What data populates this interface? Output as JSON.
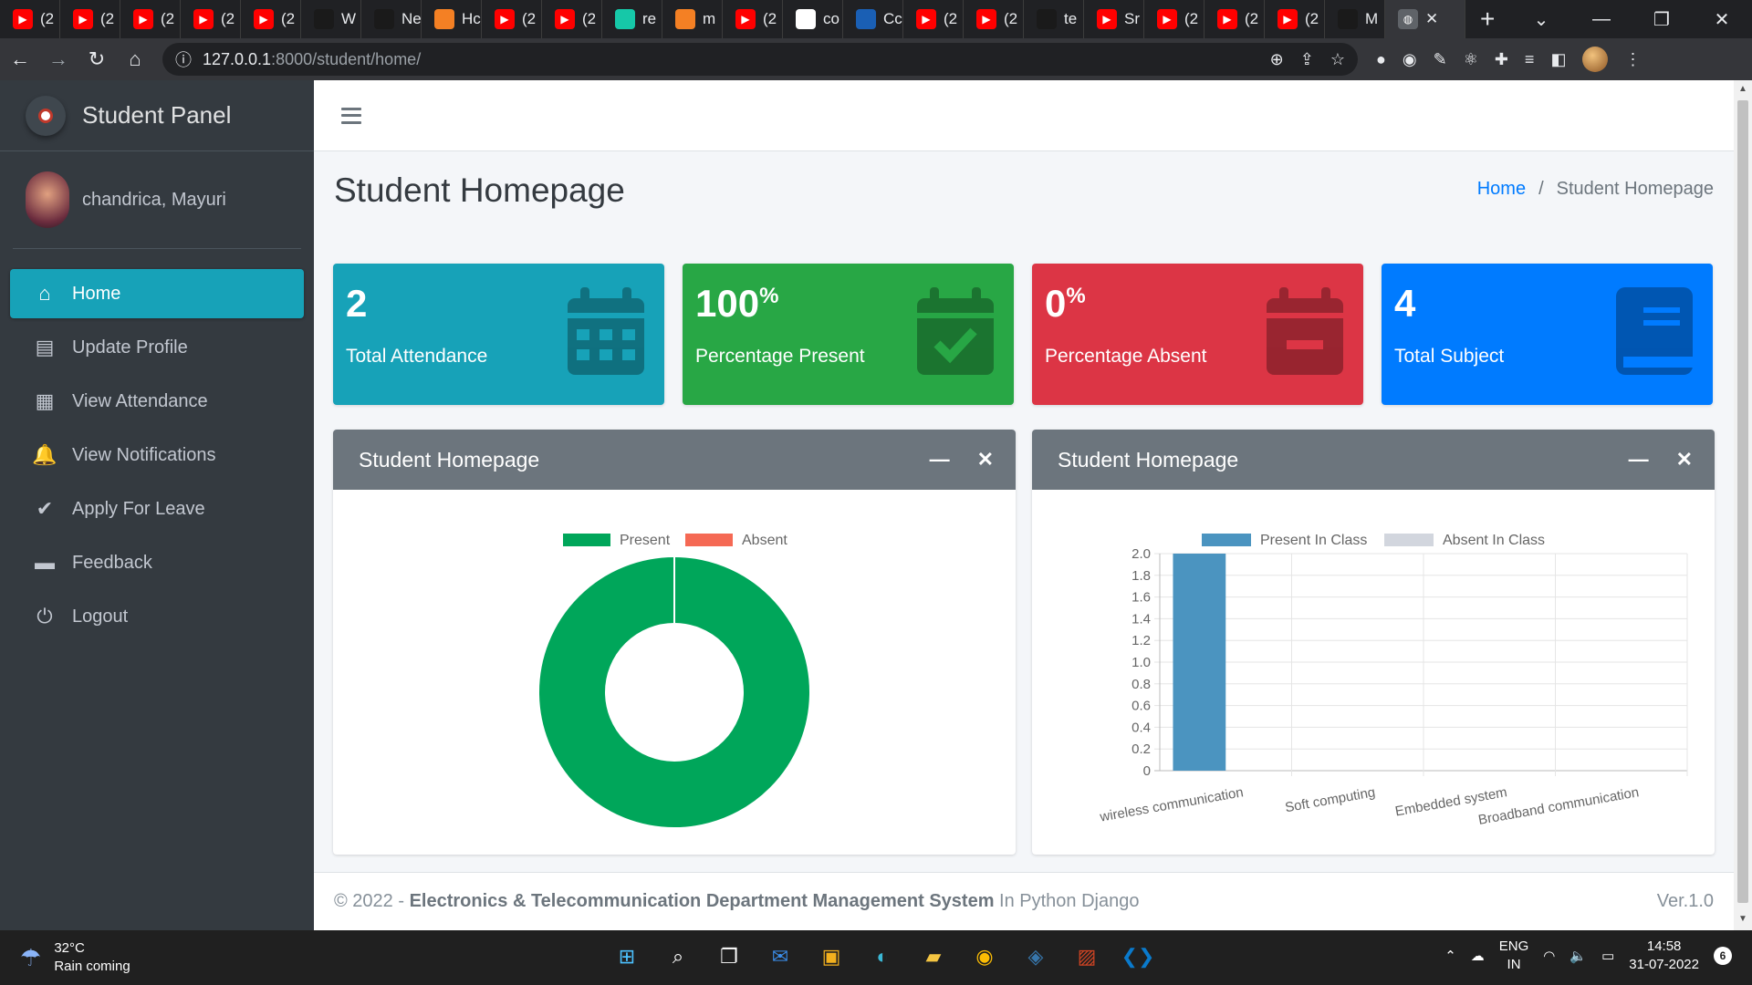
{
  "browser": {
    "tabs": [
      {
        "icon": "youtube-icon",
        "label": "(2",
        "color": "#ff0000"
      },
      {
        "icon": "youtube-icon",
        "label": "(2",
        "color": "#ff0000"
      },
      {
        "icon": "youtube-icon",
        "label": "(2",
        "color": "#ff0000"
      },
      {
        "icon": "youtube-icon",
        "label": "(2",
        "color": "#ff0000"
      },
      {
        "icon": "youtube-icon",
        "label": "(2",
        "color": "#ff0000"
      },
      {
        "icon": "whatsapp-icon",
        "label": "W",
        "color": "#1a1a1a"
      },
      {
        "icon": "github-icon",
        "label": "Ne",
        "color": "#1a1a1a"
      },
      {
        "icon": "stackoverflow-icon",
        "label": "Hc",
        "color": "#f48024"
      },
      {
        "icon": "youtube-icon",
        "label": "(2",
        "color": "#ff0000"
      },
      {
        "icon": "youtube-icon",
        "label": "(2",
        "color": "#ff0000"
      },
      {
        "icon": "app-icon",
        "label": "re",
        "color": "#16c8a8"
      },
      {
        "icon": "stackoverflow-icon",
        "label": "m",
        "color": "#f48024"
      },
      {
        "icon": "youtube-icon",
        "label": "(2",
        "color": "#ff0000"
      },
      {
        "icon": "google-icon",
        "label": "co",
        "color": "#ffffff"
      },
      {
        "icon": "codepen-icon",
        "label": "Cc",
        "color": "#1a5fb4"
      },
      {
        "icon": "youtube-icon",
        "label": "(2",
        "color": "#ff0000"
      },
      {
        "icon": "youtube-icon",
        "label": "(2",
        "color": "#ff0000"
      },
      {
        "icon": "github-icon",
        "label": "te",
        "color": "#1a1a1a"
      },
      {
        "icon": "youtube-icon",
        "label": "Sr",
        "color": "#ff0000"
      },
      {
        "icon": "youtube-icon",
        "label": "(2",
        "color": "#ff0000"
      },
      {
        "icon": "youtube-icon",
        "label": "(2",
        "color": "#ff0000"
      },
      {
        "icon": "youtube-icon",
        "label": "(2",
        "color": "#ff0000"
      },
      {
        "icon": "github-icon",
        "label": "M",
        "color": "#1a1a1a"
      }
    ],
    "active_tab_close": "✕",
    "new_tab": "+",
    "url_host": "127.0.0.1",
    "url_path": ":8000/student/home/"
  },
  "sidebar": {
    "brand": "Student Panel",
    "user_name": "chandrica, Mayuri",
    "items": [
      {
        "label": "Home",
        "icon": "home-icon",
        "glyph": "⌂",
        "active": true
      },
      {
        "label": "Update Profile",
        "icon": "id-card-icon",
        "glyph": "▤",
        "active": false
      },
      {
        "label": "View Attendance",
        "icon": "calendar-icon",
        "glyph": "▦",
        "active": false
      },
      {
        "label": "View Notifications",
        "icon": "bell-icon",
        "glyph": "🔔",
        "active": false
      },
      {
        "label": "Apply For Leave",
        "icon": "check-icon",
        "glyph": "✔",
        "active": false
      },
      {
        "label": "Feedback",
        "icon": "comment-icon",
        "glyph": "▬",
        "active": false
      },
      {
        "label": "Logout",
        "icon": "power-icon",
        "glyph": "⏻",
        "active": false
      }
    ]
  },
  "header": {
    "title": "Student Homepage",
    "breadcrumb_home": "Home",
    "breadcrumb_sep": "/",
    "breadcrumb_current": "Student Homepage"
  },
  "stats": [
    {
      "value": "2",
      "suffix": "",
      "label": "Total Attendance",
      "color": "#17a2b8",
      "icon": "calendar-icon"
    },
    {
      "value": "100",
      "suffix": "%",
      "label": "Percentage Present",
      "color": "#28a745",
      "icon": "calendar-check-icon"
    },
    {
      "value": "0",
      "suffix": "%",
      "label": "Percentage Absent",
      "color": "#dc3545",
      "icon": "calendar-minus-icon"
    },
    {
      "value": "4",
      "suffix": "",
      "label": "Total Subject",
      "color": "#007bff",
      "icon": "book-icon"
    }
  ],
  "cards": [
    {
      "title": "Student Homepage",
      "minimize": "—",
      "close": "✕"
    },
    {
      "title": "Student Homepage",
      "minimize": "—",
      "close": "✕"
    }
  ],
  "chart_data": [
    {
      "type": "pie",
      "labels": [
        "Present",
        "Absent"
      ],
      "values": [
        100,
        0
      ],
      "colors": [
        "#00a65a",
        "#f56954"
      ]
    },
    {
      "type": "bar",
      "categories": [
        "wireless communication",
        "Soft computing",
        "Embedded system",
        "Broadband communication"
      ],
      "series": [
        {
          "name": "Present In Class",
          "values": [
            2,
            0,
            0,
            0
          ],
          "color": "#4b94c0"
        },
        {
          "name": "Absent In Class",
          "values": [
            0,
            0,
            0,
            0
          ],
          "color": "#d2d6de"
        }
      ],
      "ylim": [
        0,
        2.0
      ],
      "yticks": [
        "0",
        "0.2",
        "0.4",
        "0.6",
        "0.8",
        "1.0",
        "1.2",
        "1.4",
        "1.6",
        "1.8",
        "2.0"
      ],
      "grid": true,
      "legend": "top"
    }
  ],
  "footer": {
    "copyright": "© 2022 - ",
    "system": "Electronics & Telecommunication Department Management System",
    "suffix": " In Python Django",
    "version": "Ver.1.0"
  },
  "taskbar": {
    "temp": "32°C",
    "weather": "Rain coming",
    "lang1": "ENG",
    "lang2": "IN",
    "time": "14:58",
    "date": "31-07-2022",
    "notif_count": "6"
  }
}
